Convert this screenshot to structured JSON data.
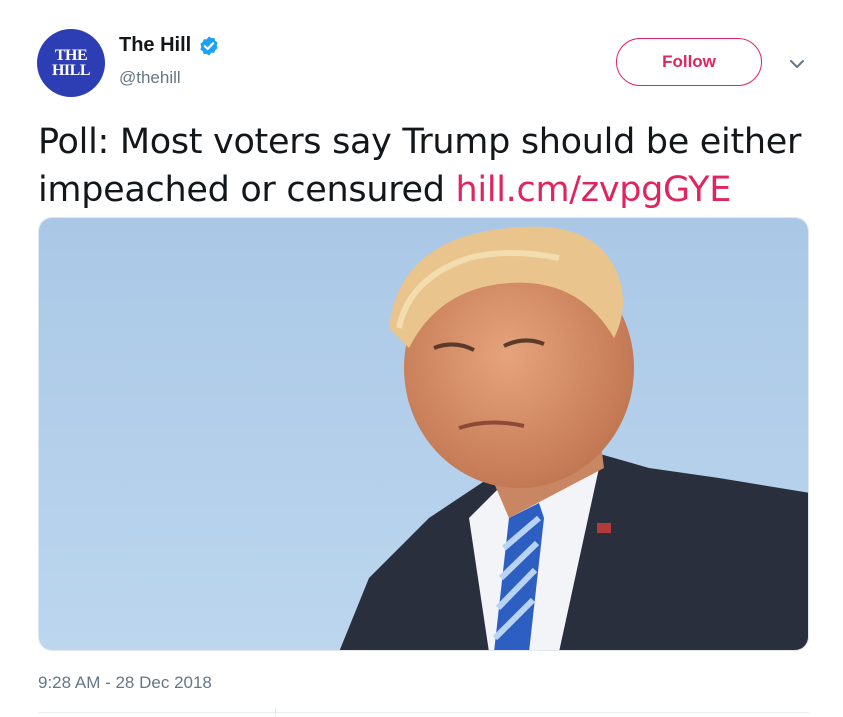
{
  "account": {
    "avatar_text_line1": "THE",
    "avatar_text_line2": "HILL",
    "display_name": "The Hill",
    "handle": "@thehill",
    "verified_icon": "verified-badge-icon"
  },
  "actions": {
    "follow_label": "Follow",
    "more_icon": "chevron-down-icon"
  },
  "tweet": {
    "text": "Poll: Most voters say Trump should be either impeached or censured ",
    "link_text": "hill.cm/zvpgGYE",
    "timestamp": "9:28 AM - 28 Dec 2018"
  },
  "colors": {
    "accent": "#e0245e",
    "verified": "#1da1f2",
    "avatar_bg": "#2d3db3",
    "secondary_text": "#657786"
  }
}
